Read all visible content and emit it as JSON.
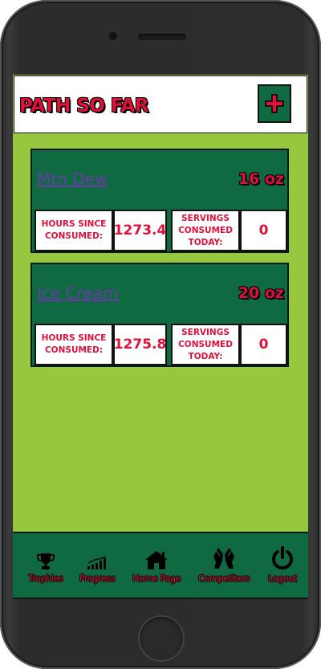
{
  "header": {
    "title": "PATH SO FAR",
    "add_icon": "plus-icon"
  },
  "colors": {
    "background": "#96c73f",
    "panel": "#0f6a42",
    "accent": "#e0103b",
    "link": "#6a3aa8"
  },
  "items": [
    {
      "name": "Mtn Dew",
      "amount": "16 oz",
      "hours_label": "HOURS SINCE CONSUMED:",
      "hours_value": "1273.4",
      "servings_label": "SERVINGS CONSUMED TODAY:",
      "servings_value": "0"
    },
    {
      "name": "Ice Cream",
      "amount": "20 oz",
      "hours_label": "HOURS SINCE CONSUMED:",
      "hours_value": "1275.8",
      "servings_label": "SERVINGS CONSUMED TODAY:",
      "servings_value": "0"
    }
  ],
  "nav": [
    {
      "label": "Trophies",
      "icon": "trophy-icon"
    },
    {
      "label": "Progress",
      "icon": "progress-chart-icon"
    },
    {
      "label": "Home Page",
      "icon": "home-icon"
    },
    {
      "label": "Competitors",
      "icon": "competitors-icon"
    },
    {
      "label": "Logout",
      "icon": "power-icon"
    }
  ]
}
